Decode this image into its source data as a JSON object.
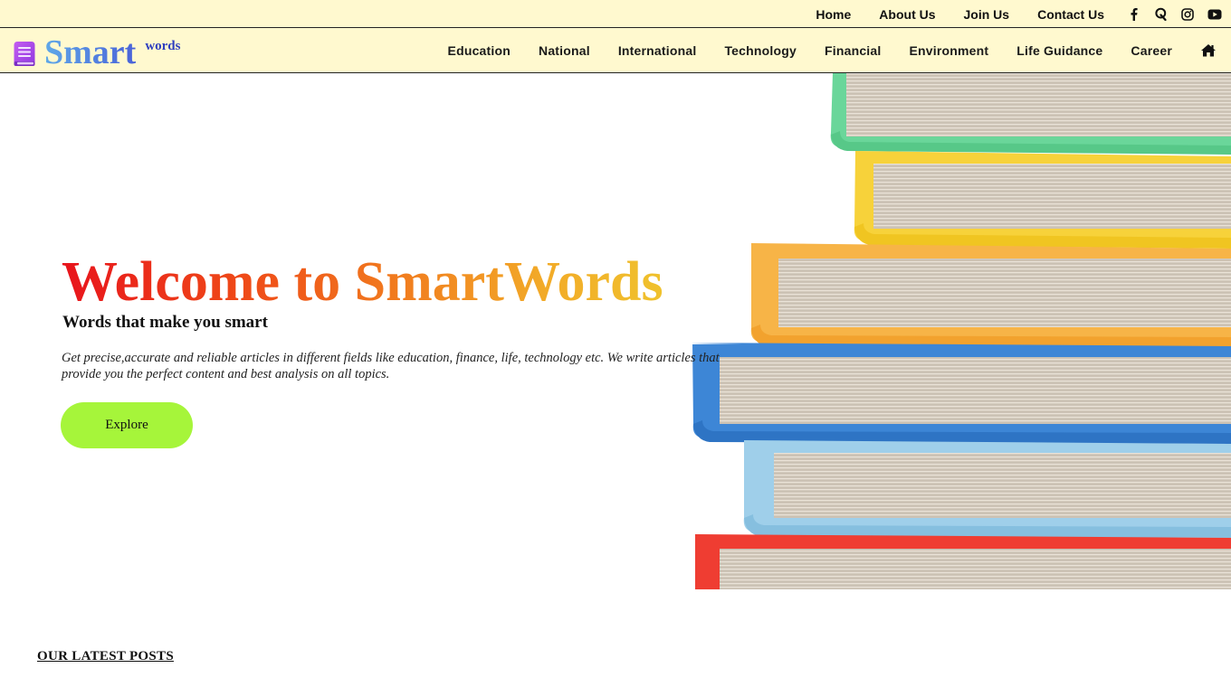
{
  "topbar": {
    "links": [
      "Home",
      "About Us",
      "Join Us",
      "Contact Us"
    ],
    "social_icons": [
      "facebook-icon",
      "quora-icon",
      "instagram-icon",
      "youtube-icon"
    ]
  },
  "brand": {
    "name_main": "Smart",
    "name_sup": "words",
    "icon": "book-icon",
    "colors": {
      "accent": "#4a62d8",
      "icon": "#b04ae8"
    }
  },
  "nav": {
    "items": [
      "Education",
      "National",
      "International",
      "Technology",
      "Financial",
      "Environment",
      "Life Guidance",
      "Career"
    ],
    "home_icon": "home-icon"
  },
  "hero": {
    "title": "Welcome to SmartWords",
    "subtitle": "Words that make you smart",
    "description": "Get precise,accurate and reliable articles in different fields like education, finance, life, technology etc. We write articles that provide you the perfect content and best analysis on all topics.",
    "cta_label": "Explore",
    "cta_color": "#a6f53a",
    "image": "stack-of-books-image"
  },
  "latest": {
    "heading": "OUR LATEST POSTS"
  }
}
